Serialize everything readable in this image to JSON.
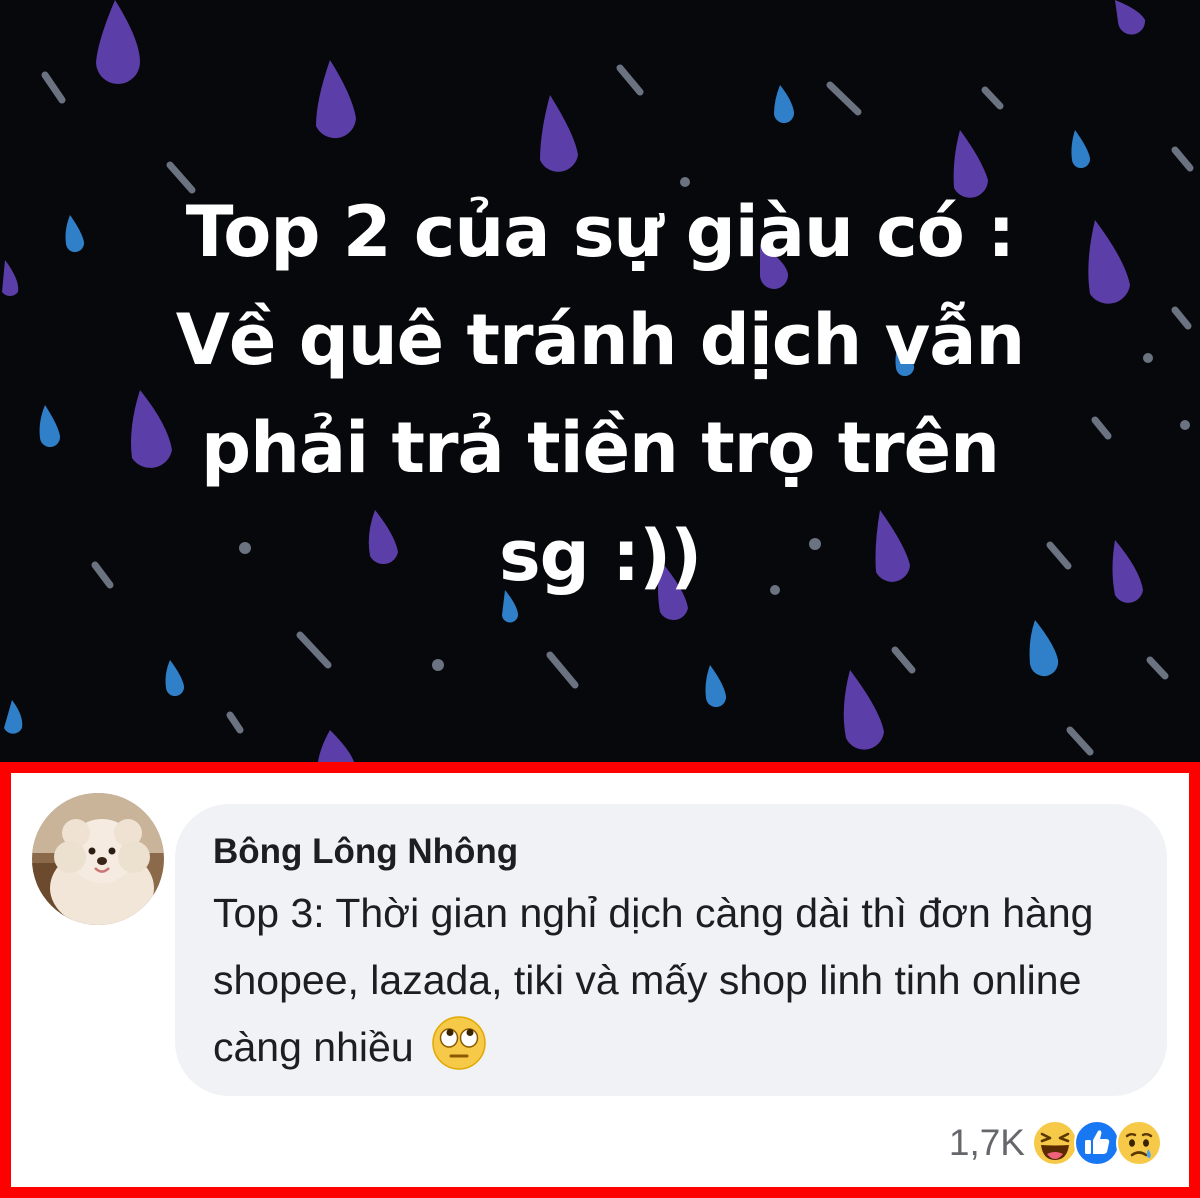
{
  "post": {
    "background_color": "#07080c",
    "text_lines": [
      "Top 2 của sự giàu có :",
      "Về quê tránh dịch vẫn",
      "phải trả tiền trọ trên",
      "sg :))"
    ]
  },
  "highlight_color": "#ff0000",
  "comment": {
    "author": "Bông Lông Nhông",
    "text": "Top 3: Thời gian nghỉ dịch càng dài thì đơn hàng shopee, lazada, tiki và mấy shop linh tinh online càng nhiều",
    "trailing_emoji": "eye-roll-emoji-icon",
    "avatar": "poodle-dog-avatar",
    "reaction_count": "1,7K",
    "reactions": [
      "haha-reaction-icon",
      "like-reaction-icon",
      "sad-reaction-icon"
    ]
  }
}
